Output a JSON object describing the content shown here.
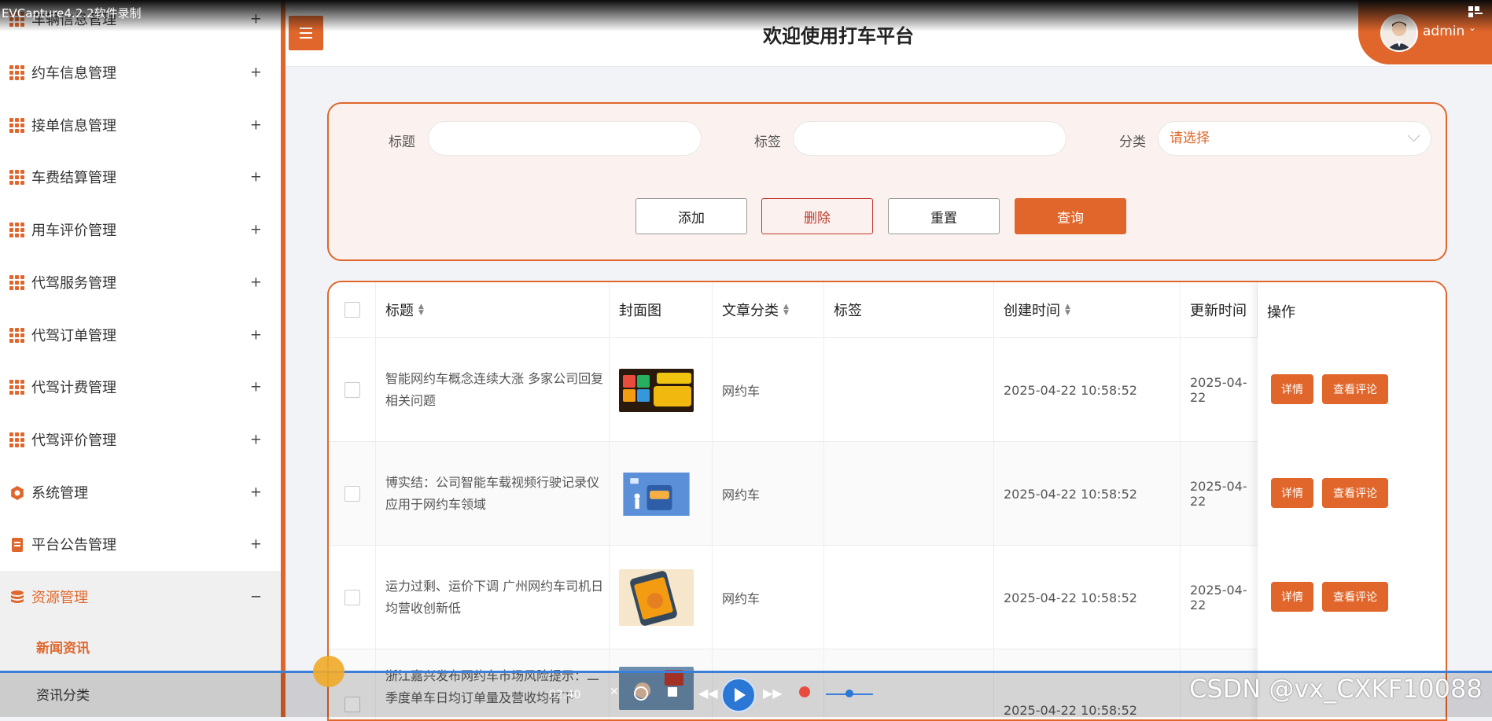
{
  "capture": {
    "title": "EVCapture4.2.2软件录制"
  },
  "colors": {
    "accent": "#e0662b",
    "danger": "#c0392b",
    "player_blue": "#2a77d6"
  },
  "sidebar": {
    "items": [
      {
        "label": "车辆信息管理",
        "icon": "grid-icon",
        "toggle": "+"
      },
      {
        "label": "约车信息管理",
        "icon": "grid-icon",
        "toggle": "+"
      },
      {
        "label": "接单信息管理",
        "icon": "grid-icon",
        "toggle": "+"
      },
      {
        "label": "车费结算管理",
        "icon": "grid-icon",
        "toggle": "+"
      },
      {
        "label": "用车评价管理",
        "icon": "grid-icon",
        "toggle": "+"
      },
      {
        "label": "代驾服务管理",
        "icon": "grid-icon",
        "toggle": "+"
      },
      {
        "label": "代驾订单管理",
        "icon": "grid-icon",
        "toggle": "+"
      },
      {
        "label": "代驾计费管理",
        "icon": "grid-icon",
        "toggle": "+"
      },
      {
        "label": "代驾评价管理",
        "icon": "grid-icon",
        "toggle": "+"
      },
      {
        "label": "系统管理",
        "icon": "gear-icon",
        "toggle": "+"
      },
      {
        "label": "平台公告管理",
        "icon": "document-icon",
        "toggle": "+"
      },
      {
        "label": "资源管理",
        "icon": "database-icon",
        "toggle": "−"
      }
    ],
    "submenu": [
      {
        "label": "新闻资讯"
      },
      {
        "label": "资讯分类"
      }
    ]
  },
  "header": {
    "title": "欢迎使用打车平台",
    "user": "admin"
  },
  "search": {
    "title_label": "标题",
    "tag_label": "标签",
    "category_label": "分类",
    "category_placeholder": "请选择",
    "buttons": {
      "add": "添加",
      "delete": "删除",
      "reset": "重置",
      "query": "查询"
    }
  },
  "table": {
    "headers": {
      "title": "标题",
      "cover": "封面图",
      "category": "文章分类",
      "tag": "标签",
      "created": "创建时间",
      "updated": "更新时间",
      "ops": "操作"
    },
    "rows": [
      {
        "title": "智能网约车概念连续大涨 多家公司回复相关问题",
        "category": "网约车",
        "tag": "",
        "created": "2025-04-22 10:58:52",
        "updated": "2025-04-22",
        "detail": "详情",
        "comments": "查看评论"
      },
      {
        "title": "博实结：公司智能车载视频行驶记录仪应用于网约车领域",
        "category": "网约车",
        "tag": "",
        "created": "2025-04-22 10:58:52",
        "updated": "2025-04-22",
        "detail": "详情",
        "comments": "查看评论"
      },
      {
        "title": "运力过剩、运价下调 广州网约车司机日均营收创新低",
        "category": "网约车",
        "tag": "",
        "created": "2025-04-22 10:58:52",
        "updated": "2025-04-22",
        "detail": "详情",
        "comments": "查看评论"
      },
      {
        "title": "浙江嘉兴发布网约车市场风险提示：二季度单车日均订单量及营收均有下",
        "category": "",
        "tag": "",
        "created": "2025-04-22 10:58:52",
        "updated": "",
        "detail": "",
        "comments": ""
      }
    ]
  },
  "player": {
    "time": "02:40"
  },
  "watermark": "CSDN @vx_CXKF10088"
}
